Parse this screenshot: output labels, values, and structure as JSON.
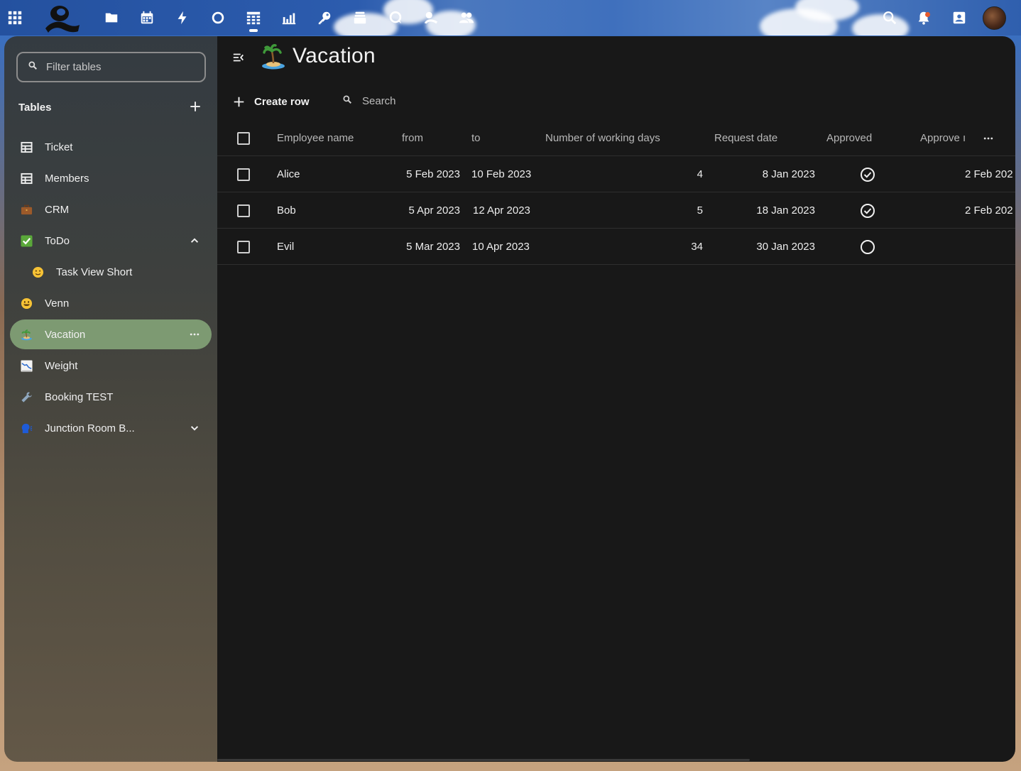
{
  "topbar": {
    "apps": [
      {
        "name": "files-icon"
      },
      {
        "name": "calendar-icon"
      },
      {
        "name": "activity-icon"
      },
      {
        "name": "circles-icon"
      },
      {
        "name": "tables-icon"
      },
      {
        "name": "analytics-icon"
      },
      {
        "name": "passwords-icon"
      },
      {
        "name": "deck-icon"
      },
      {
        "name": "talk-icon"
      },
      {
        "name": "collectives-icon"
      },
      {
        "name": "contacts-icon"
      }
    ],
    "colors": {
      "accent": "#2c5cae",
      "notification": "#e65a2c"
    }
  },
  "sidebar": {
    "filter_placeholder": "Filter tables",
    "heading": "Tables",
    "items": [
      {
        "label": "Ticket",
        "icon": "table-icon"
      },
      {
        "label": "Members",
        "icon": "table-icon"
      },
      {
        "label": "CRM",
        "icon": "briefcase-emoji"
      },
      {
        "label": "ToDo",
        "icon": "check-mark-emoji"
      },
      {
        "label": "Task View Short",
        "icon": "slightly-smiling-face-emoji"
      },
      {
        "label": "Venn",
        "icon": "grinning-face-emoji"
      },
      {
        "label": "Vacation",
        "icon": "desert-island-emoji"
      },
      {
        "label": "Weight",
        "icon": "chart-decreasing-emoji"
      },
      {
        "label": "Booking TEST",
        "icon": "wrench-emoji"
      },
      {
        "label": "Junction Room B...",
        "icon": "speaking-head-emoji"
      }
    ],
    "active_color": "#7d9a72"
  },
  "main": {
    "title": "Vacation",
    "create_row_label": "Create row",
    "search_placeholder": "Search",
    "columns": [
      "Employee name",
      "from",
      "to",
      "Number of working days",
      "Request date",
      "Approved",
      "Approve ı"
    ],
    "rows": [
      {
        "name": "Alice",
        "from": "5 Feb 2023",
        "to": "10 Feb 2023",
        "days": "4",
        "request": "8 Jan 2023",
        "approved": true,
        "approved_on": "2 Feb 202"
      },
      {
        "name": "Bob",
        "from": "5 Apr 2023",
        "to": "12 Apr 2023",
        "days": "5",
        "request": "18 Jan 2023",
        "approved": true,
        "approved_on": "2 Feb 202"
      },
      {
        "name": "Evil",
        "from": "5 Mar 2023",
        "to": "10 Apr 2023",
        "days": "34",
        "request": "30 Jan 2023",
        "approved": false,
        "approved_on": ""
      }
    ]
  }
}
